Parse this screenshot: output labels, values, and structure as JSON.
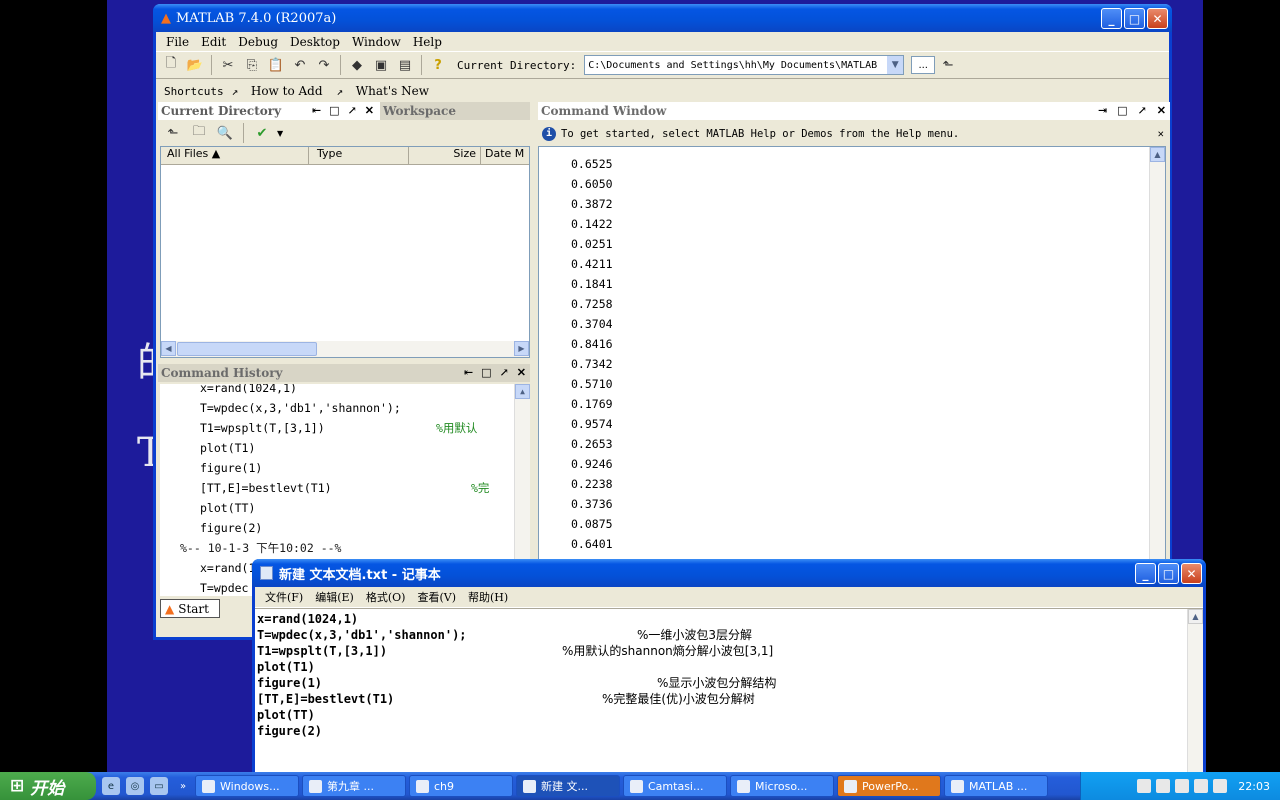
{
  "matlab": {
    "title": "MATLAB  7.4.0 (R2007a)",
    "menus": [
      "File",
      "Edit",
      "Debug",
      "Desktop",
      "Window",
      "Help"
    ],
    "current_dir_label": "Current Directory:",
    "current_dir_value": "C:\\Documents and Settings\\hh\\My Documents\\MATLAB",
    "browse_label": "...",
    "shortcuts": [
      "Shortcuts",
      "How to Add",
      "What's New"
    ],
    "current_directory_panel": {
      "title": "Current Directory",
      "tab2": "Workspace",
      "columns": [
        "All Files",
        "Type",
        "Size",
        "Date M"
      ]
    },
    "history": {
      "title": "Command History",
      "lines": [
        {
          "text": "x=rand(1024,1)",
          "comment": ""
        },
        {
          "text": "T=wpdec(x,3,'db1','shannon');",
          "comment": ""
        },
        {
          "text": "T1=wpsplt(T,[3,1])",
          "comment": "%用默认"
        },
        {
          "text": "plot(T1)",
          "comment": ""
        },
        {
          "text": "figure(1)",
          "comment": ""
        },
        {
          "text": "[TT,E]=bestlevt(T1)",
          "comment": "%完"
        },
        {
          "text": "plot(TT)",
          "comment": ""
        },
        {
          "text": "figure(2)",
          "comment": ""
        },
        {
          "text": "%-- 10-1-3  下午10:02 --%",
          "comment": ""
        },
        {
          "text": "x=rand(1",
          "comment": ""
        },
        {
          "text": "T=wpdec",
          "comment": ""
        }
      ]
    },
    "command_window": {
      "title": "Command Window",
      "info": "To get started, select MATLAB Help or Demos from the Help menu.",
      "values": [
        "0.6525",
        "0.6050",
        "0.3872",
        "0.1422",
        "0.0251",
        "0.4211",
        "0.1841",
        "0.7258",
        "0.3704",
        "0.8416",
        "0.7342",
        "0.5710",
        "0.1769",
        "0.9574",
        "0.2653",
        "0.9246",
        "0.2238",
        "0.3736",
        "0.0875",
        "0.6401"
      ]
    },
    "start_button": "Start"
  },
  "notepad": {
    "title": "新建 文本文档.txt - 记事本",
    "menus": [
      "文件(F)",
      "编辑(E)",
      "格式(O)",
      "查看(V)",
      "帮助(H)"
    ],
    "lines": [
      {
        "code": "x=rand(1024,1)",
        "comment": ""
      },
      {
        "code": "T=wpdec(x,3,'db1','shannon');",
        "comment": "%一维小波包3层分解"
      },
      {
        "code": "T1=wpsplt(T,[3,1])",
        "comment": "%用默认的shannon熵分解小波包[3,1]"
      },
      {
        "code": "plot(T1)",
        "comment": ""
      },
      {
        "code": "figure(1)",
        "comment": "%显示小波包分解结构"
      },
      {
        "code": "[TT,E]=bestlevt(T1)",
        "comment": "%完整最佳(优)小波包分解树"
      },
      {
        "code": "plot(TT)",
        "comment": ""
      },
      {
        "code": "figure(2)",
        "comment": ""
      }
    ]
  },
  "taskbar": {
    "start": "开始",
    "tasks": [
      "Windows...",
      "第九章 ...",
      "ch9",
      "新建 文...",
      "Camtasi...",
      "Microso...",
      "PowerPo...",
      "MATLAB ..."
    ],
    "clock": "22:03"
  },
  "desktop": {
    "chars": [
      "的",
      "T"
    ]
  }
}
